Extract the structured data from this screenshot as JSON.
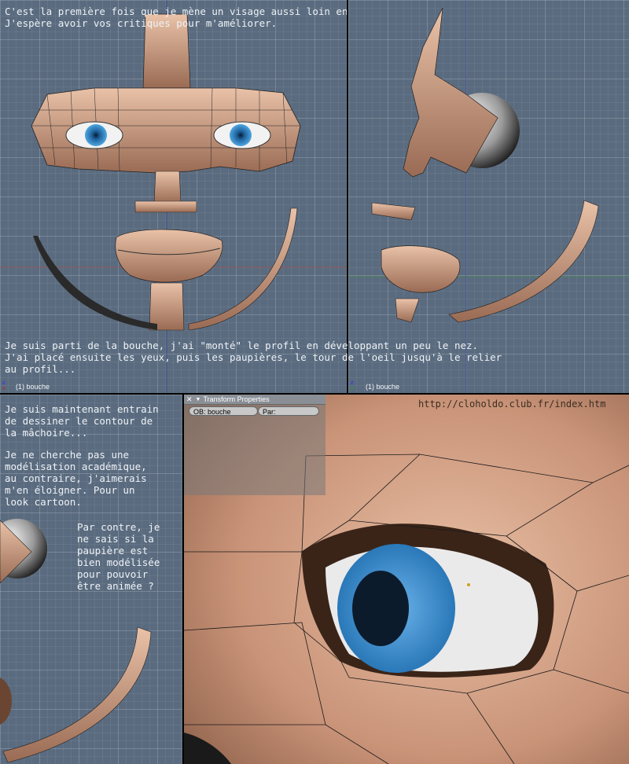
{
  "text": {
    "intro_line1": "C'est la première fois que je mène un visage aussi loin en modélisation...",
    "intro_line2": "J'espère avoir vos critiques pour m'améliorer.",
    "middle_line1": "Je suis parti de la bouche, j'ai \"monté\" le profil en développant un peu le nez.",
    "middle_line2": "J'ai placé ensuite les yeux, puis les paupières, le tour de l'oeil jusqu'à le relier",
    "middle_line3": "au profil...",
    "left_p1_l1": "Je suis maintenant entrain",
    "left_p1_l2": "de dessiner le contour de",
    "left_p1_l3": "la mâchoire...",
    "left_p2_l1": "Je ne cherche pas une",
    "left_p2_l2": "modélisation académique,",
    "left_p2_l3": "au contraire, j'aimerais",
    "left_p2_l4": "m'en éloigner. Pour un",
    "left_p2_l5": "look cartoon.",
    "left_p3_l1": "Par contre, je",
    "left_p3_l2": "ne sais si la",
    "left_p3_l3": "paupière est",
    "left_p3_l4": "bien modélisée",
    "left_p3_l5": "pour pouvoir",
    "left_p3_l6": "être animée ?",
    "url": "http://cloholdo.club.fr/index.htm"
  },
  "viewports": {
    "front_label": "(1) bouche",
    "side_label": "(1) bouche"
  },
  "transform_panel": {
    "title": "Transform Properties",
    "ob_field": "OB: bouche",
    "par_field": "Par:"
  },
  "colors": {
    "viewport_bg": "#5a6b7f",
    "skin": "#d8a68a",
    "iris": "#3a8fd0",
    "text": "#eef2f6"
  }
}
